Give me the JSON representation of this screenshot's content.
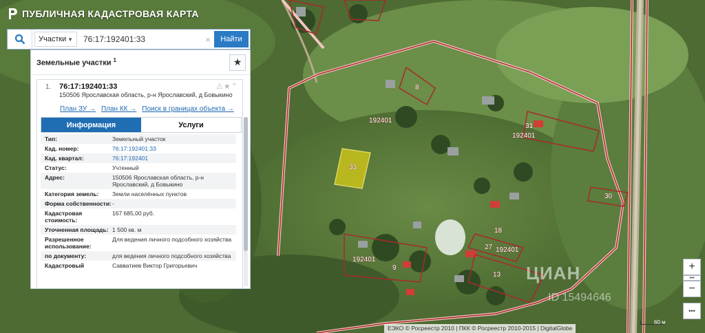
{
  "app": {
    "title": "ПУБЛИЧНАЯ КАДАСТРОВАЯ КАРТА"
  },
  "search": {
    "type_label": "Участки",
    "query": "76:17:192401:33",
    "submit_label": "Найти"
  },
  "panel": {
    "title": "Земельные участки",
    "count": "1"
  },
  "result": {
    "number": "1.",
    "cad_number": "76:17:192401:33",
    "address": "150506 Ярославская область, р-н Ярославский, д Бовыкино",
    "links": [
      "План ЗУ →",
      "План КК →",
      "Поиск в границах объекта →"
    ],
    "tabs": [
      "Информация",
      "Услуги"
    ],
    "info": [
      {
        "k": "Тип:",
        "v": "Земельный участок"
      },
      {
        "k": "Кад. номер:",
        "v": "76:17:192401:33"
      },
      {
        "k": "Кад. квартал:",
        "v": "76:17:192401"
      },
      {
        "k": "Статус:",
        "v": "Учтенный"
      },
      {
        "k": "Адрес:",
        "v": "150506 Ярославская область, р-н Ярославский, д Бовыкино"
      },
      {
        "k": "Категория земель:",
        "v": "Земли населённых пунктов"
      },
      {
        "k": "Форма собственности:",
        "v": "-"
      },
      {
        "k": "Кадастровая стоимость:",
        "v": "167 685,00 руб."
      },
      {
        "k": "Уточненная площадь:",
        "v": "1 500 кв. м"
      },
      {
        "k": "Разрешенное использование:",
        "v": "Для ведения личного подсобного хозяйства"
      },
      {
        "k": "по документу:",
        "v": "для ведения личного подсобного хозяйства"
      },
      {
        "k": "Кадастровый",
        "v": "Савватиев Виктор Григорьевич"
      }
    ]
  },
  "map": {
    "labels": [
      "192401",
      "192401",
      "192401",
      "192401",
      "33",
      "8",
      "31",
      "30",
      "18",
      "27",
      "9",
      "13"
    ],
    "watermark": "ЦИАН",
    "watermark_id": "ID 15494646",
    "scale": "60 м",
    "attribution": "ЕЭКО © Росреестр 2010 | ПКК © Росреестр 2010-2015 | DigitalGlobe"
  },
  "controls": {
    "zoom_in": "+",
    "zoom_out": "−",
    "more": "•••"
  },
  "colors": {
    "accent": "#1f6db3",
    "boundary": "#f2c6c2",
    "parcel_fill": "#c9c21c"
  }
}
